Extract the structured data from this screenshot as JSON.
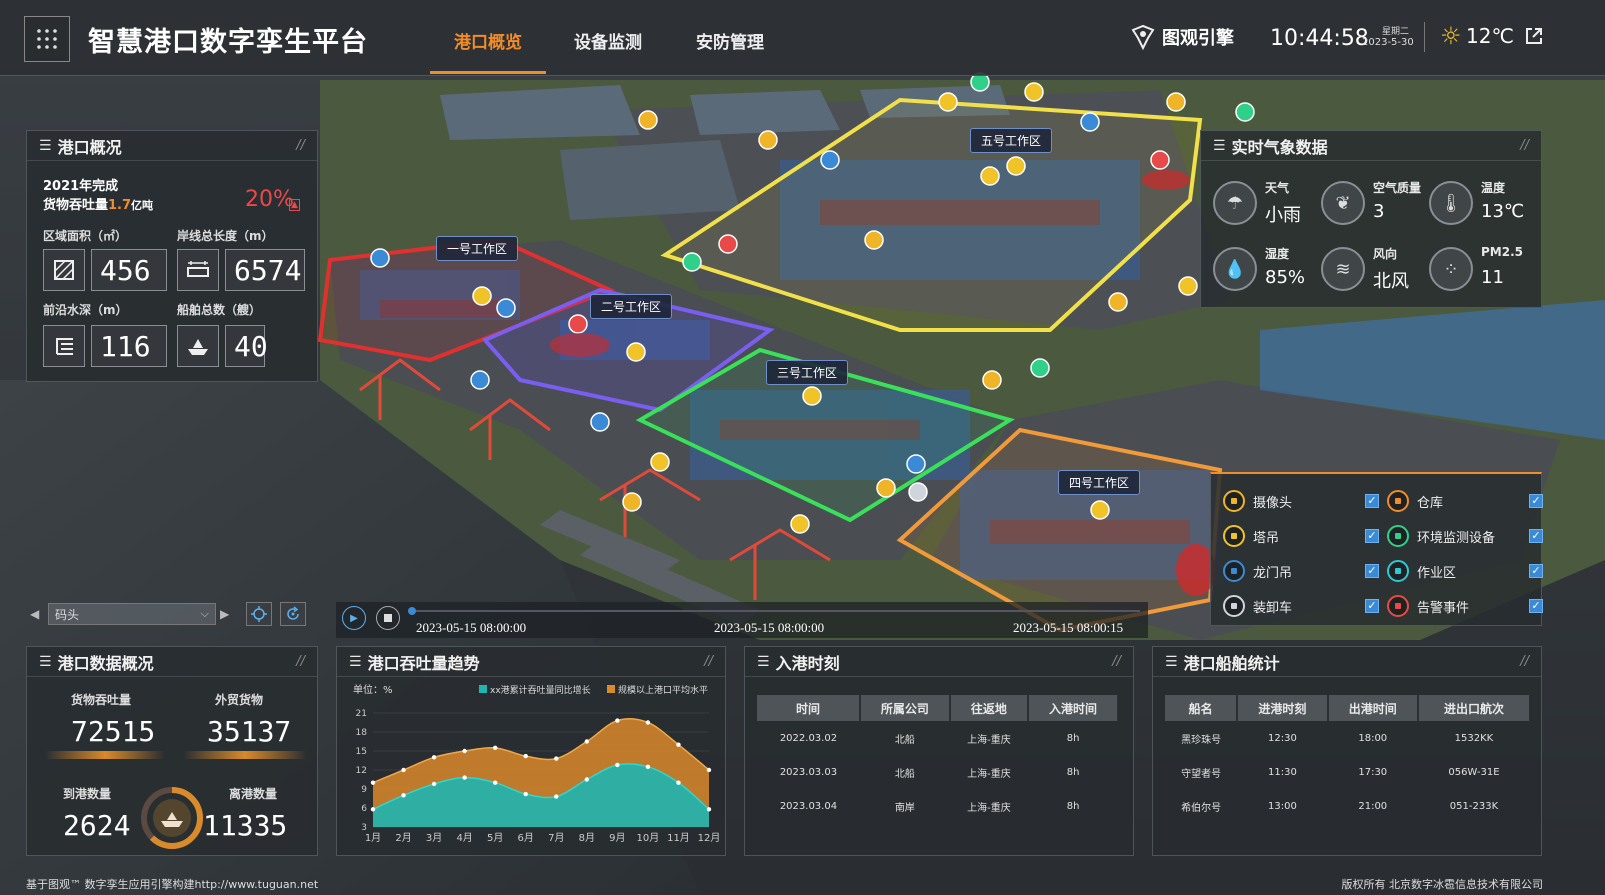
{
  "header": {
    "title": "智慧港口数字孪生平台",
    "tabs": [
      {
        "label": "港口概览",
        "active": true
      },
      {
        "label": "设备监测",
        "active": false
      },
      {
        "label": "安防管理",
        "active": false
      }
    ],
    "brand": "图观引擎",
    "time": "10:44:58",
    "weekday": "星期二",
    "date": "2023-5-30",
    "temperature": "12℃"
  },
  "zones": [
    "五号工作区",
    "一号工作区",
    "二号工作区",
    "三号工作区",
    "四号工作区"
  ],
  "overview": {
    "title": "港口概况",
    "year_line": "2021年完成",
    "throughput_prefix": "货物吞吐量",
    "throughput_value": "1.7",
    "throughput_unit": "亿吨",
    "growth": "20%",
    "growth_arrow": "▲",
    "stats": [
      {
        "label": "区域面积（㎡）",
        "value": "456",
        "icon": "area-icon"
      },
      {
        "label": "岸线总长度（m）",
        "value": "6574",
        "icon": "shoreline-icon"
      },
      {
        "label": "前沿水深（m）",
        "value": "116",
        "icon": "depth-icon"
      },
      {
        "label": "船舶总数（艘）",
        "value": "40",
        "icon": "ship-icon"
      }
    ]
  },
  "weather": {
    "title": "实时气象数据",
    "items": [
      {
        "label": "天气",
        "value": "小雨",
        "icon": "rain-icon"
      },
      {
        "label": "空气质量",
        "value": "3",
        "icon": "leaf-icon"
      },
      {
        "label": "温度",
        "value": "13℃",
        "icon": "thermometer-icon"
      },
      {
        "label": "湿度",
        "value": "85%",
        "icon": "humidity-icon"
      },
      {
        "label": "风向",
        "value": "北风",
        "icon": "wind-icon"
      },
      {
        "label": "PM2.5",
        "value": "11",
        "icon": "pm25-icon"
      }
    ]
  },
  "legend": {
    "items": [
      {
        "label": "摄像头",
        "icon": "camera-icon",
        "color": "#f0b429",
        "checked": true
      },
      {
        "label": "仓库",
        "icon": "warehouse-icon",
        "color": "#f08c29",
        "checked": true
      },
      {
        "label": "塔吊",
        "icon": "tower-crane-icon",
        "color": "#f0c429",
        "checked": true
      },
      {
        "label": "环境监测设备",
        "icon": "env-monitor-icon",
        "color": "#2fd18a",
        "checked": true
      },
      {
        "label": "龙门吊",
        "icon": "gantry-crane-icon",
        "color": "#3a8ad6",
        "checked": true
      },
      {
        "label": "作业区",
        "icon": "work-zone-icon",
        "color": "#2fc9d1",
        "checked": true
      },
      {
        "label": "装卸车",
        "icon": "loader-truck-icon",
        "color": "#cfd5db",
        "checked": true
      },
      {
        "label": "告警事件",
        "icon": "alarm-icon",
        "color": "#e84a4a",
        "checked": true
      }
    ]
  },
  "layer_select": {
    "value": "码头"
  },
  "timeline": {
    "labels": [
      "2023-05-15 08:00:00",
      "2023-05-15 08:00:00",
      "2023-05-15 08:00:15"
    ],
    "progress": 0
  },
  "data_overview": {
    "title": "港口数据概况",
    "cargo_label": "货物吞吐量",
    "cargo_value": "72515",
    "foreign_label": "外贸货物",
    "foreign_value": "35137",
    "arrive_label": "到港数量",
    "arrive_value": "2624",
    "depart_label": "离港数量",
    "depart_value": "11335"
  },
  "trend": {
    "title": "港口吞吐量趋势"
  },
  "chart_data": {
    "type": "area",
    "unit_label": "单位：%",
    "categories": [
      "1月",
      "2月",
      "3月",
      "4月",
      "5月",
      "6月",
      "7月",
      "8月",
      "9月",
      "10月",
      "11月",
      "12月"
    ],
    "series": [
      {
        "name": "xx港累计吞吐量同比增长",
        "color": "#1fb5b0",
        "values": [
          5.8,
          8,
          9.8,
          10.8,
          10,
          8.2,
          7.8,
          10.5,
          12.8,
          12.5,
          10,
          5.8
        ]
      },
      {
        "name": "规模以上港口平均水平",
        "color": "#d98a2a",
        "values": [
          10,
          12,
          14,
          15,
          15.5,
          14.2,
          13.8,
          16.5,
          19.8,
          19.5,
          16,
          12
        ]
      }
    ],
    "ylim": [
      3,
      21
    ],
    "yticks": [
      3,
      6,
      9,
      12,
      15,
      18,
      21
    ]
  },
  "arrivals": {
    "title": "入港时刻",
    "columns": [
      "时间",
      "所属公司",
      "往返地",
      "入港时间"
    ],
    "rows": [
      [
        "2022.03.02",
        "北船",
        "上海-重庆",
        "8h"
      ],
      [
        "2023.03.03",
        "北船",
        "上海-重庆",
        "8h"
      ],
      [
        "2023.03.04",
        "南岸",
        "上海-重庆",
        "8h"
      ]
    ]
  },
  "ships": {
    "title": "港口船舶统计",
    "columns": [
      "船名",
      "进港时刻",
      "出港时间",
      "进出口航次"
    ],
    "rows": [
      [
        "黑珍珠号",
        "12:30",
        "18:00",
        "1532KK"
      ],
      [
        "守望者号",
        "11:30",
        "17:30",
        "056W-31E"
      ],
      [
        "希伯尔号",
        "13:00",
        "21:00",
        "051-233K"
      ]
    ]
  },
  "footer": {
    "left": "基于图观™ 数字孪生应用引擎构建http://www.tuguan.net",
    "right": "版权所有 北京数字冰雹信息技术有限公司"
  }
}
